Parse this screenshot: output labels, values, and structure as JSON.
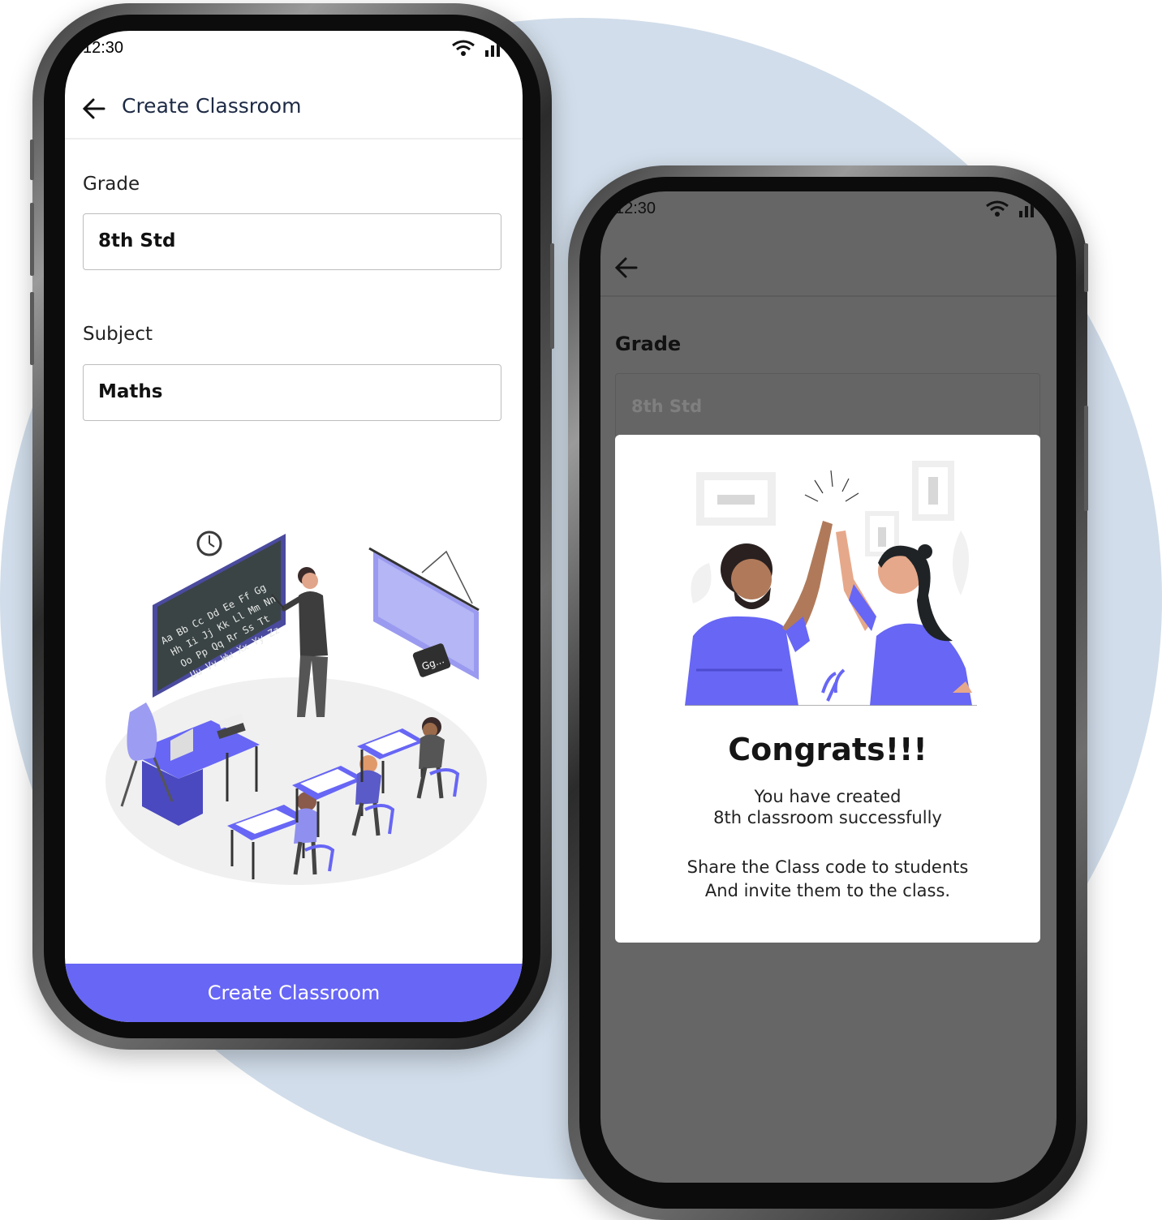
{
  "colors": {
    "accent": "#6766F5",
    "background_circle": "#D1DDEA",
    "overlay": "#666666"
  },
  "phone1": {
    "status_time": "12:30",
    "appbar_title": "Create Classroom",
    "grade_label": "Grade",
    "grade_value": "8th Std",
    "subject_label": "Subject",
    "subject_value": "Maths",
    "blackboard_text": [
      "Aa Bb Cc Dd Ee Ff Gg",
      "Hh Ii Jj Kk Ll Mm Nn",
      "Oo Pp Qq Rr Ss Tt",
      "Uu Vv Ww Xx Yy Zz"
    ],
    "speech_bubble": "Gg...",
    "cta_label": "Create Classroom"
  },
  "phone2": {
    "status_time": "12:30",
    "grade_label": "Grade",
    "grade_value": "8th Std",
    "dialog": {
      "title": "Congrats!!!",
      "line1": "You have created",
      "line2": "8th classroom successfully",
      "line3": "Share the Class code to students",
      "line4": "And invite them to the class."
    }
  }
}
